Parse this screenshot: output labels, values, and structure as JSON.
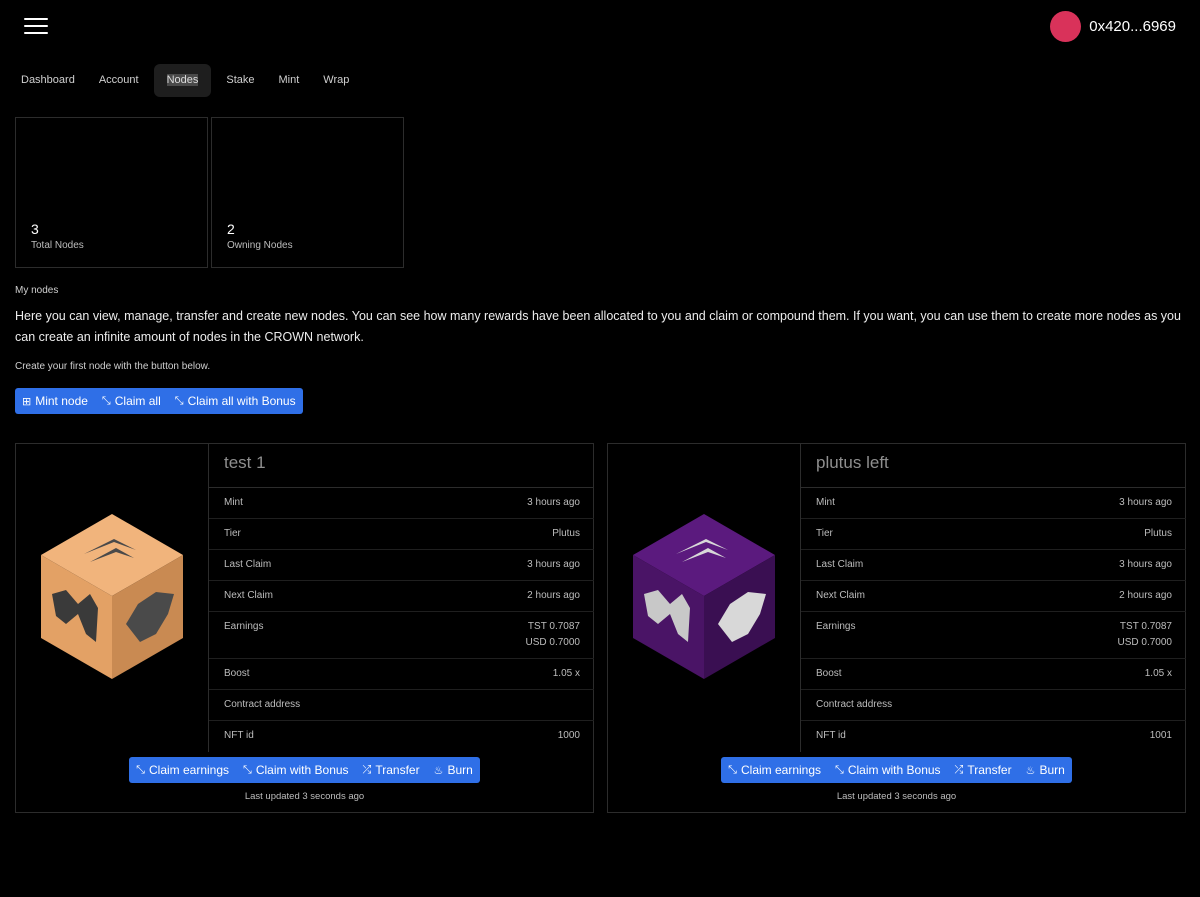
{
  "header": {
    "wallet_address": "0x420...6969",
    "avatar_color": "#d9325a"
  },
  "nav": {
    "tabs": [
      {
        "label": "Dashboard"
      },
      {
        "label": "Account"
      },
      {
        "label": "Nodes",
        "active": true
      },
      {
        "label": "Stake"
      },
      {
        "label": "Mint"
      },
      {
        "label": "Wrap"
      }
    ]
  },
  "stats": [
    {
      "value": "3",
      "label": "Total Nodes"
    },
    {
      "value": "2",
      "label": "Owning Nodes"
    }
  ],
  "my_nodes": {
    "title": "My nodes",
    "description": "Here you can view, manage, transfer and create new nodes. You can see how many rewards have been allocated to you and claim or compound them. If you want, you can use them to create more nodes as you can create an infinite amount of nodes in the CROWN network.",
    "hint": "Create your first node with the button below.",
    "actions": {
      "mint": "Mint node",
      "claim_all": "Claim all",
      "claim_all_bonus": "Claim all with Bonus"
    }
  },
  "node_labels": {
    "mint": "Mint",
    "tier": "Tier",
    "last_claim": "Last Claim",
    "next_claim": "Next Claim",
    "earnings": "Earnings",
    "boost": "Boost",
    "contract": "Contract address",
    "nft_id": "NFT id",
    "claim_earnings": "Claim earnings",
    "claim_bonus": "Claim with Bonus",
    "transfer": "Transfer",
    "burn": "Burn"
  },
  "nodes": [
    {
      "name": "test 1",
      "mint": "3 hours ago",
      "tier": "Plutus",
      "last_claim": "3 hours ago",
      "next_claim": "2 hours ago",
      "earnings_tst": "TST 0.7087",
      "earnings_usd": "USD 0.7000",
      "boost": "1.05 x",
      "contract": "",
      "nft_id": "1000",
      "updated": "Last updated 3 seconds ago",
      "cube_color": "#e8a064"
    },
    {
      "name": "plutus left",
      "mint": "3 hours ago",
      "tier": "Plutus",
      "last_claim": "3 hours ago",
      "next_claim": "2 hours ago",
      "earnings_tst": "TST 0.7087",
      "earnings_usd": "USD 0.7000",
      "boost": "1.05 x",
      "contract": "",
      "nft_id": "1001",
      "updated": "Last updated 3 seconds ago",
      "cube_color": "#4a1466"
    }
  ],
  "colors": {
    "primary": "#2f6fe7",
    "border": "#2c2c2c"
  }
}
